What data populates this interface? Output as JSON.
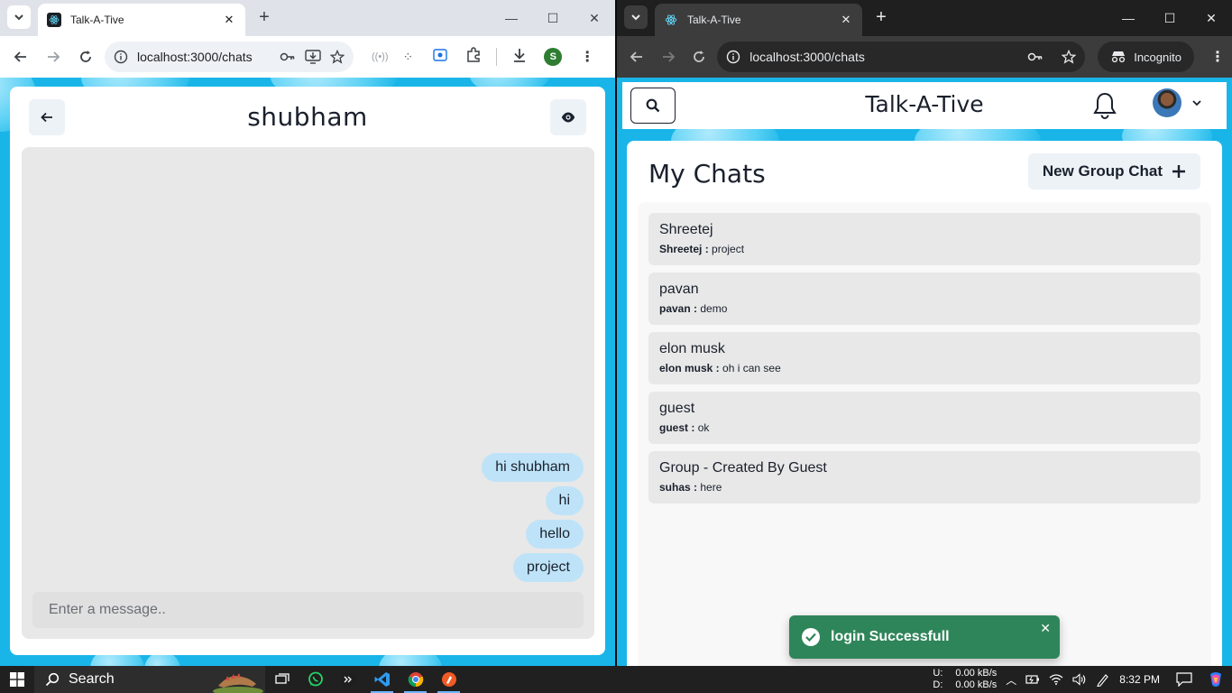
{
  "left_window": {
    "tab_title": "Talk-A-Tive",
    "url": "localhost:3000/chats",
    "profile_initial": "S",
    "chat": {
      "title": "shubham",
      "messages": [
        "hi shubham",
        "hi",
        "hello",
        "project"
      ],
      "input_placeholder": "Enter a message.."
    }
  },
  "right_window": {
    "tab_title": "Talk-A-Tive",
    "url": "localhost:3000/chats",
    "incognito_label": "Incognito",
    "app_title": "Talk-A-Tive",
    "my_chats_title": "My Chats",
    "new_group_label": "New Group Chat",
    "chats": [
      {
        "name": "Shreetej",
        "sender": "Shreetej :",
        "message": "project"
      },
      {
        "name": "pavan",
        "sender": "pavan :",
        "message": "demo"
      },
      {
        "name": "elon musk",
        "sender": "elon musk :",
        "message": "oh i can see"
      },
      {
        "name": "guest",
        "sender": "guest :",
        "message": "ok"
      },
      {
        "name": "Group - Created By Guest",
        "sender": "suhas :",
        "message": "here"
      }
    ],
    "toast": "login Successfull"
  },
  "taskbar": {
    "search_label": "Search",
    "net_up_label": "U:",
    "net_down_label": "D:",
    "net_up": "0.00 kB/s",
    "net_down": "0.00 kB/s",
    "time": "8:32 PM"
  },
  "colors": {
    "page_bg": "#19b5e8",
    "message_bubble": "#bee3f8",
    "toast_bg": "#2f855a"
  }
}
